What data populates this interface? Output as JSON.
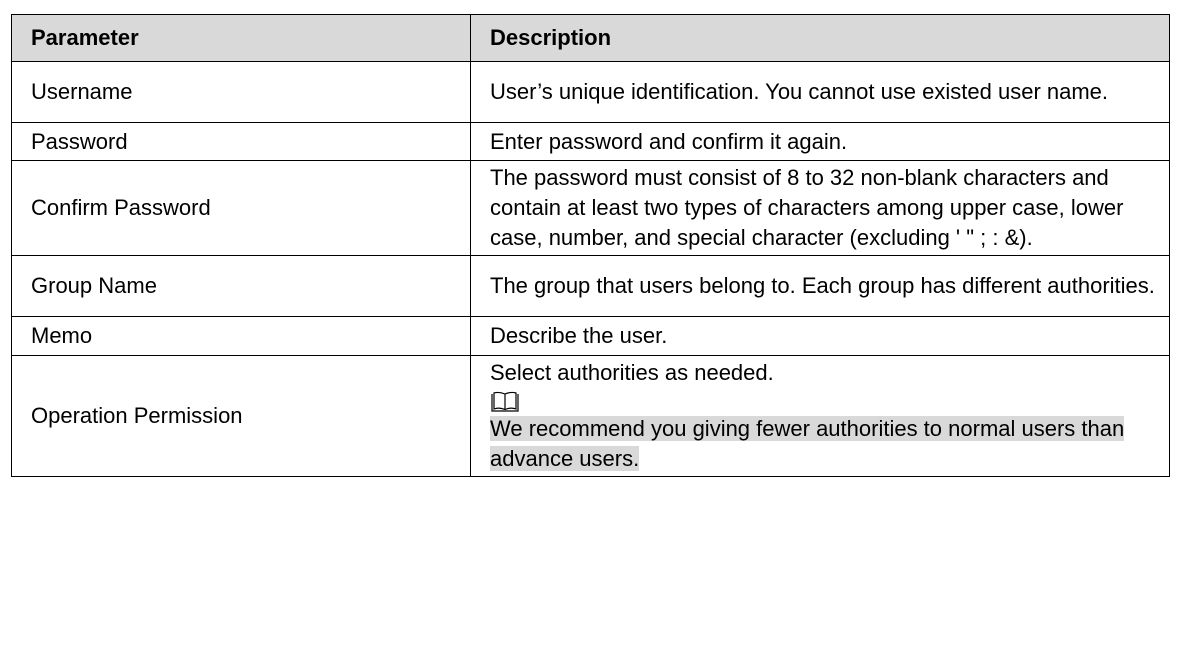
{
  "table": {
    "header": {
      "parameter": "Parameter",
      "description": "Description"
    },
    "rows": {
      "username": {
        "parameter": "Username",
        "description": "User’s unique identification. You cannot use existed user name."
      },
      "password": {
        "parameter": "Password",
        "description": "Enter password and confirm it again."
      },
      "confirm_password": {
        "parameter": "Confirm Password",
        "description": "The password must consist of 8 to 32 non-blank characters and contain at least two types of characters among upper case, lower case, number, and special character (excluding ' \" ; : &)."
      },
      "group_name": {
        "parameter": "Group Name",
        "description": "The group that users belong to. Each group has different authorities."
      },
      "memo": {
        "parameter": "Memo",
        "description": "Describe the user."
      },
      "operation_permission": {
        "parameter": "Operation Permission",
        "description": "Select authorities as needed.",
        "note_icon": "book-icon",
        "note": "We recommend you giving fewer authorities to normal users than advance users."
      }
    }
  },
  "colors": {
    "header_background": "#d9d9d9",
    "note_highlight": "#d9d9d9",
    "border": "#000000"
  }
}
